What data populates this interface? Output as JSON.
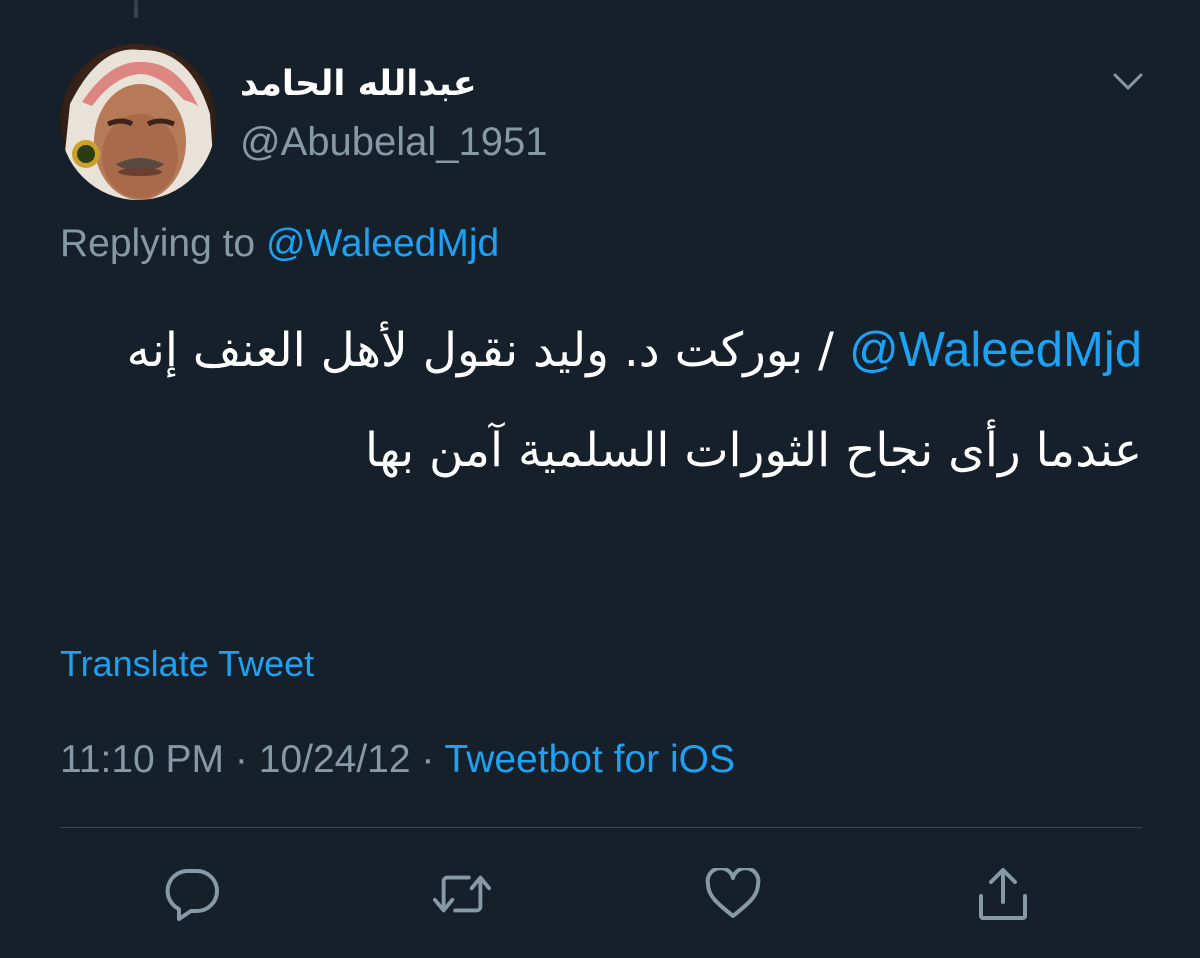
{
  "tweet": {
    "display_name": "عبدالله الحامد",
    "handle": "@Abubelal_1951",
    "replying_prefix": "Replying to",
    "replying_to": "@WaleedMjd",
    "body_mention": "@WaleedMjd",
    "body_text": "/ بوركت د. وليد نقول لأهل العنف إنه عندما رأى نجاح الثورات السلمية آمن بها",
    "translate_label": "Translate Tweet",
    "time": "11:10 PM",
    "separator": "·",
    "date": "10/24/12",
    "source": "Tweetbot for iOS"
  },
  "actions": [
    {
      "icon": "reply-icon"
    },
    {
      "icon": "retweet-icon"
    },
    {
      "icon": "like-icon"
    },
    {
      "icon": "share-icon"
    }
  ],
  "colors": {
    "background": "#15202b",
    "text_primary": "#ffffff",
    "text_secondary": "#8899a6",
    "accent": "#1da1f2",
    "divider": "#38444d"
  }
}
